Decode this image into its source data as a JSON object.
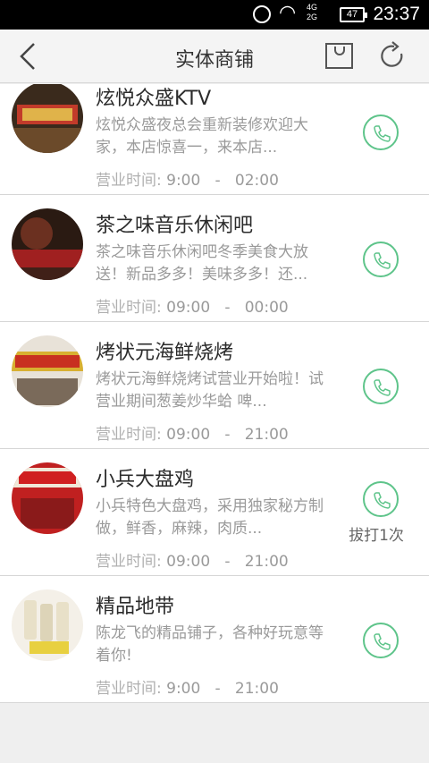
{
  "status_bar": {
    "time": "23:37",
    "battery": "47",
    "network_top": "4G",
    "network_bottom": "2G"
  },
  "nav": {
    "title": "实体商铺"
  },
  "shops": [
    {
      "name": "炫悦众盛KTV",
      "desc": "炫悦众盛夜总会重新装修欢迎大家，本店惊喜一，来本店...",
      "hours_label": "营业时间:",
      "open": "9:00",
      "sep": "-",
      "close": "02:00",
      "call_count": ""
    },
    {
      "name": "茶之味音乐休闲吧",
      "desc": "茶之味音乐休闲吧冬季美食大放送！新品多多！美味多多！还...",
      "hours_label": "营业时间:",
      "open": "09:00",
      "sep": "-",
      "close": "00:00",
      "call_count": ""
    },
    {
      "name": "烤状元海鲜烧烤",
      "desc": "烤状元海鲜烧烤试营业开始啦！试营业期间葱姜炒华蛤 啤...",
      "hours_label": "营业时间:",
      "open": "09:00",
      "sep": "-",
      "close": "21:00",
      "call_count": ""
    },
    {
      "name": "小兵大盘鸡",
      "desc": "小兵特色大盘鸡，采用独家秘方制做，鲜香，麻辣，肉质...",
      "hours_label": "营业时间:",
      "open": "09:00",
      "sep": "-",
      "close": "21:00",
      "call_count": "拔打1次"
    },
    {
      "name": "精品地带",
      "desc": "陈龙飞的精品铺子，各种好玩意等着你!",
      "hours_label": "营业时间:",
      "open": "9:00",
      "sep": "-",
      "close": "21:00",
      "call_count": ""
    }
  ],
  "colors": {
    "accent_green": "#5ec48a",
    "text_gray": "#9a9a9a"
  },
  "icons": {
    "back": "chevron-left-icon",
    "cart": "shopping-bag-icon",
    "refresh": "refresh-icon",
    "call": "phone-icon"
  }
}
